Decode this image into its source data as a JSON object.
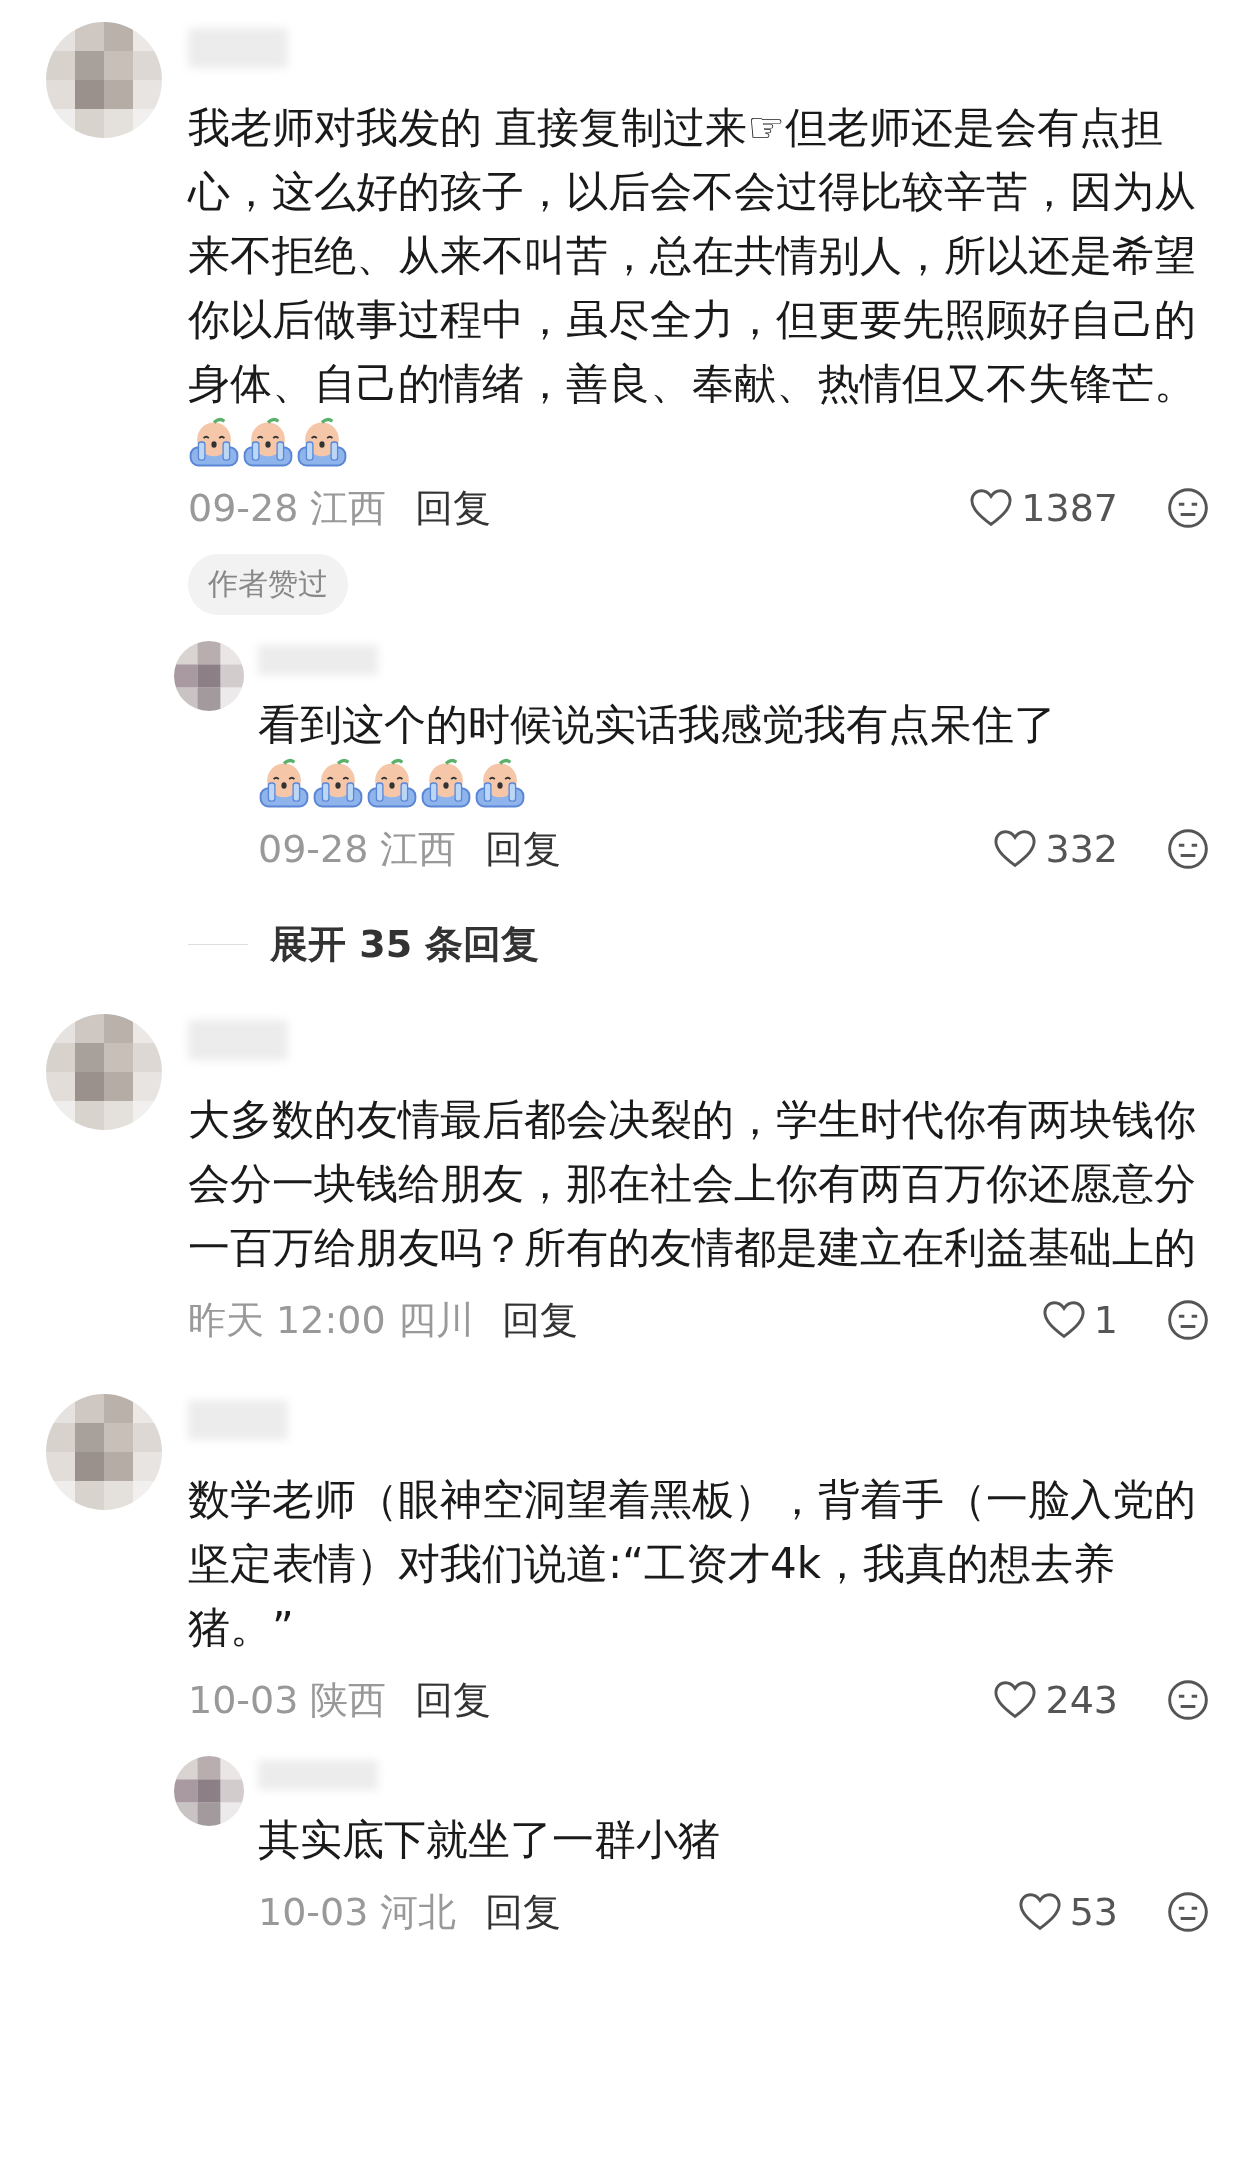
{
  "comments": [
    {
      "text": "我老师对我发的 直接复制过来☞但老师还是会有点担心，这么好的孩子，以后会不会过得比较辛苦，因为从来不拒绝、从来不叫苦，总在共情别人，所以还是希望你以后做事过程中，虽尽全力，但更要先照顾好自己的身体、自己的情绪，善良、奉献、热情但又不失锋芒。",
      "stickers": [
        {
          "kind": "crying"
        },
        {
          "kind": "crying"
        },
        {
          "kind": "crying"
        }
      ],
      "meta": "09-28 江西",
      "reply_label": "回复",
      "likes": "1387",
      "badge": "作者赞过",
      "replies": [
        {
          "text": "看到这个的时候说实话我感觉我有点呆住了",
          "stickers": [
            {
              "kind": "crying"
            },
            {
              "kind": "crying"
            },
            {
              "kind": "crying"
            },
            {
              "kind": "crying"
            },
            {
              "kind": "crying"
            }
          ],
          "meta": "09-28 江西",
          "reply_label": "回复",
          "likes": "332"
        }
      ],
      "expand_label": "展开 35 条回复"
    },
    {
      "text": "大多数的友情最后都会决裂的，学生时代你有两块钱你会分一块钱给朋友，那在社会上你有两百万你还愿意分一百万给朋友吗？所有的友情都是建立在利益基础上的",
      "meta": "昨天 12:00 四川",
      "reply_label": "回复",
      "likes": "1"
    },
    {
      "text": "数学老师（眼神空洞望着黑板），背着手（一脸入党的坚定表情）对我们说道:“工资才4k，我真的想去养猪。”",
      "meta": "10-03 陕西",
      "reply_label": "回复",
      "likes": "243",
      "replies": [
        {
          "text": "其实底下就坐了一群小猪",
          "meta": "10-03 河北",
          "reply_label": "回复",
          "likes": "53"
        }
      ]
    }
  ]
}
